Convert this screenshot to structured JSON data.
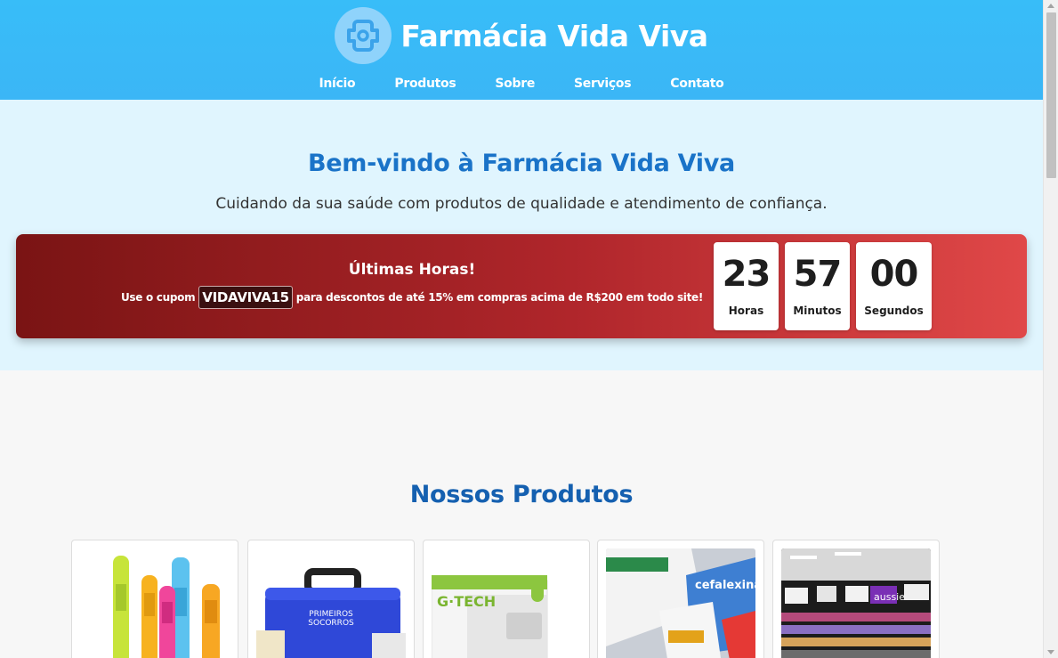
{
  "header": {
    "brand_name": "Farmácia Vida Viva",
    "logo_icon": "medical-cross-icon",
    "nav": [
      "Início",
      "Produtos",
      "Sobre",
      "Serviços",
      "Contato"
    ]
  },
  "hero": {
    "title": "Bem-vindo à Farmácia Vida Viva",
    "subtitle": "Cuidando da sua saúde com produtos de qualidade e atendimento de confiança."
  },
  "promo": {
    "title": "Últimas Horas!",
    "line_before": "Use o cupom",
    "coupon": "VIDAVIVA15",
    "line_after": "para descontos de até 15% em compras acima de R$200 em todo site!",
    "timer": [
      {
        "value": "23",
        "label": "Horas"
      },
      {
        "value": "57",
        "label": "Minutos"
      },
      {
        "value": "00",
        "label": "Segundos"
      }
    ]
  },
  "products": {
    "title": "Nossos Produtos",
    "cards": [
      {
        "image": "thermometers-image"
      },
      {
        "image": "first-aid-kit-image",
        "image_text": "PRIMEIROS SOCORROS"
      },
      {
        "image": "blood-pressure-monitor-image",
        "image_text": "G·TECH"
      },
      {
        "image": "medicine-boxes-image",
        "image_text": "cefalexina"
      },
      {
        "image": "store-shelves-image",
        "image_text": "aussie"
      }
    ]
  },
  "colors": {
    "header_bg": "#38bdf8",
    "hero_bg": "#e0f5fe",
    "title_blue": "#1a73c8",
    "promo_dark": "#7a1414",
    "promo_light": "#e04848"
  }
}
